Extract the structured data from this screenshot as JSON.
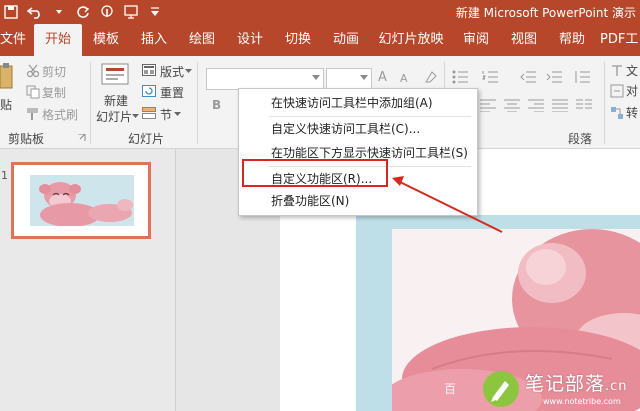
{
  "titlebar": {
    "title": "新建 Microsoft PowerPoint 演示"
  },
  "tabs": [
    {
      "label": "文件"
    },
    {
      "label": "开始"
    },
    {
      "label": "模板"
    },
    {
      "label": "插入"
    },
    {
      "label": "绘图"
    },
    {
      "label": "设计"
    },
    {
      "label": "切换"
    },
    {
      "label": "动画"
    },
    {
      "label": "幻灯片放映"
    },
    {
      "label": "审阅"
    },
    {
      "label": "视图"
    },
    {
      "label": "帮助"
    },
    {
      "label": "PDF工"
    }
  ],
  "ribbon": {
    "clipboard": {
      "paste": "贴",
      "cut": "剪切",
      "copy": "复制",
      "format_painter": "格式刷",
      "group_label": "剪贴板"
    },
    "slides": {
      "new_slide_line1": "新建",
      "new_slide_line2": "幻灯片",
      "layout": "版式",
      "reset": "重置",
      "section": "节",
      "group_label": "幻灯片"
    },
    "font": {
      "bold": "B"
    },
    "paragraph": {
      "group_label": "段落"
    },
    "right_partial": {
      "item1": "文",
      "item2": "对",
      "item3": "转"
    }
  },
  "slide_pane": {
    "slide_number": "1"
  },
  "context_menu": {
    "items": [
      {
        "label": "在快速访问工具栏中添加组(A)"
      },
      {
        "label": "自定义快速访问工具栏(C)..."
      },
      {
        "label": "在功能区下方显示快速访问工具栏(S)"
      },
      {
        "label": "自定义功能区(R)..."
      },
      {
        "label": "折叠功能区(N)"
      }
    ]
  },
  "watermark": {
    "left_text": "百",
    "title": "笔记部落",
    "suffix": ".cn",
    "sub": "www.notetribe.com"
  },
  "colors": {
    "accent": "#b7472a",
    "highlight": "#d7281e",
    "thumb_border": "#e0725a"
  }
}
